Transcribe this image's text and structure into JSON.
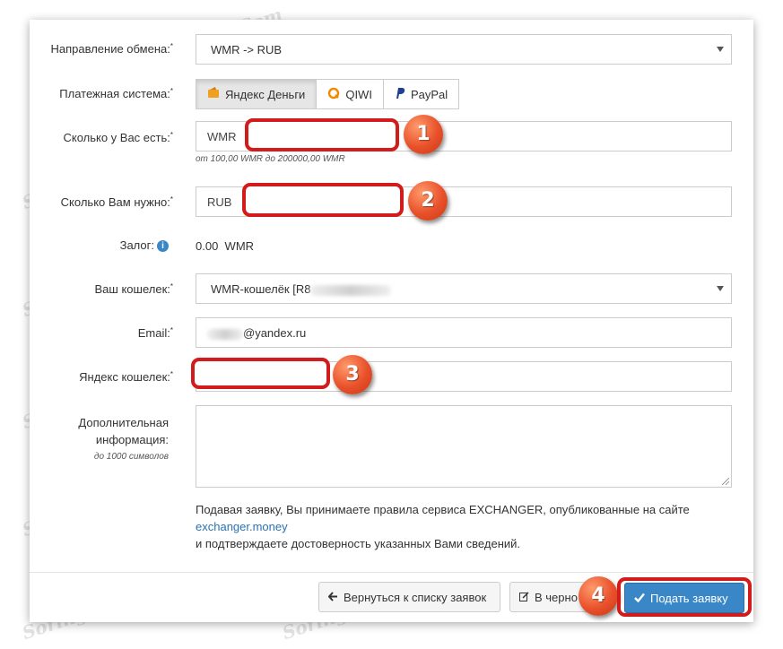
{
  "form": {
    "direction": {
      "label": "Направление обмена:",
      "value": "WMR -> RUB"
    },
    "payment_system": {
      "label": "Платежная система:",
      "options": [
        {
          "label": "Яндекс Деньги",
          "icon": "yandex-money-icon",
          "active": true
        },
        {
          "label": "QIWI",
          "icon": "qiwi-icon",
          "active": false
        },
        {
          "label": "PayPal",
          "icon": "paypal-icon",
          "active": false
        }
      ]
    },
    "have": {
      "label": "Сколько у Вас есть:",
      "currency": "WMR",
      "hint": "от 100,00 WMR до 200000,00 WMR"
    },
    "need": {
      "label": "Сколько Вам нужно:",
      "currency": "RUB"
    },
    "deposit": {
      "label": "Залог:",
      "value": "0.00",
      "currency": "WMR"
    },
    "wallet": {
      "label": "Ваш кошелек:",
      "value": "WMR-кошелёк [R8"
    },
    "email": {
      "label": "Email:",
      "value": "@yandex.ru"
    },
    "yandex_wallet": {
      "label": "Яндекс кошелек:"
    },
    "extra": {
      "label_line1": "Дополнительная",
      "label_line2": "информация:",
      "hint": "до 1000 символов"
    },
    "terms": {
      "line1": "Подавая заявку, Вы принимаете правила сервиса EXCHANGER, опубликованные на сайте",
      "link": "exchanger.money",
      "line2": "и подтверждаете достоверность указанных Вами сведений."
    }
  },
  "buttons": {
    "back": "Вернуться к списку заявок",
    "draft": "В черно",
    "submit": "Подать заявку"
  },
  "badges": [
    "1",
    "2",
    "3",
    "4"
  ],
  "watermark": "Soringpcrepair.Com",
  "colors": {
    "primary": "#3a87c8",
    "highlight": "#d21b1b",
    "badge": "#e8502a"
  }
}
